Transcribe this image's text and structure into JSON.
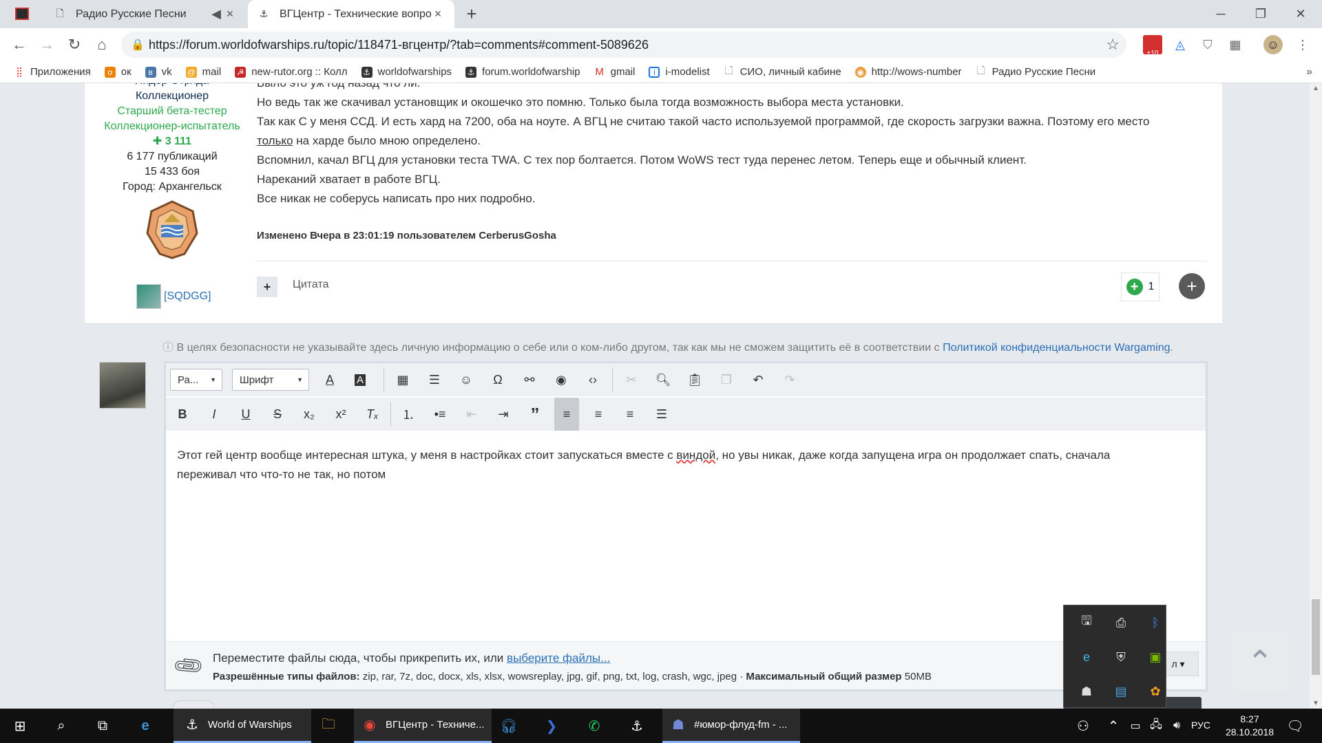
{
  "tabs": [
    {
      "title": "Радио Русские Песни",
      "icon": "document-icon"
    },
    {
      "title": "ВГЦентр - Технические вопросы",
      "icon": "wows-icon"
    }
  ],
  "new_tab_symbol": "+",
  "url": "https://forum.worldofwarships.ru/topic/118471-вгцентр/?tab=comments#comment-5089626",
  "extension_badge": "+10",
  "bookmarks": [
    {
      "label": "Приложения",
      "icon": "apps-icon",
      "color": "#e8453c"
    },
    {
      "label": "ок",
      "icon": "ok-icon",
      "color": "#ee8208"
    },
    {
      "label": "vk",
      "icon": "vk-icon",
      "color": "#4a76a8"
    },
    {
      "label": "mail",
      "icon": "mail-icon",
      "color": "#f5a623"
    },
    {
      "label": "new-rutor.org :: Колл",
      "icon": "rutor-icon",
      "color": "#c62828"
    },
    {
      "label": "worldofwarships",
      "icon": "wows-icon",
      "color": "#333"
    },
    {
      "label": "forum.worldofwarship",
      "icon": "wows-icon",
      "color": "#333"
    },
    {
      "label": "gmail",
      "icon": "gmail-icon",
      "color": "#d93025"
    },
    {
      "label": "i-modelist",
      "icon": "doc-icon",
      "color": "#1a73e8"
    },
    {
      "label": "СИО, личный кабине",
      "icon": "document-icon",
      "color": "#777"
    },
    {
      "label": "http://wows-number",
      "icon": "globe-icon",
      "color": "#f09a3e"
    },
    {
      "label": "Радио Русские Песни",
      "icon": "document-icon",
      "color": "#777"
    }
  ],
  "author": {
    "rank_partial": "Лидер Отряда",
    "title": "Коллекционер",
    "badge1": "Старший бета-тестер",
    "badge2": "Коллекционер-испытатель",
    "reputation": "3 111",
    "posts": "6 177 публикаций",
    "battles": "15 433 боя",
    "city": "Город: Архангельск",
    "clan": "[SQDGG]"
  },
  "post": {
    "lines": [
      "Было это уж год назад что ли.",
      "Но ведь так же скачивал установщик и окошечко это помню. Только была тогда возможность выбора места установки.",
      "Так как С у меня ССД. И есть хард на 7200, оба на ноуте. А ВГЦ не считаю такой часто используемой программой, где скорость загрузки важна. Поэтому его место",
      "на харде было мною определено.",
      "Вспомнил, качал ВГЦ для установки теста TWA. С тех пор болтается. Потом WoWS тест туда перенес летом. Теперь еще и обычный клиент.",
      "Нареканий хватает в работе ВГЦ.",
      "Все никак не соберусь написать про них подробно."
    ],
    "underlined_word": "только",
    "edited": "Изменено Вчера в 23:01:19 пользователем CerberusGosha",
    "quote": "Цитата",
    "plus": "+",
    "rep_count": "1"
  },
  "privacy": {
    "text": "В целях безопасности не указывайте здесь личную информацию о себе или о ком-либо другом, так как мы не сможем защитить её в соответствии с",
    "link": "Политикой конфиденциальности Wargaming",
    "end": "."
  },
  "editor": {
    "format_select": "Ра...",
    "font_select": "Шрифт",
    "text_before": "Этот гей центр вообще интересная штука, у меня в настройках стоит запускаться вместе с",
    "misspelled": "виндой",
    "text_after": ", но увы никак, даже когда запущена игра он продолжает спать, сначала",
    "text_line2": "переживал что что-то не так, но потом"
  },
  "attach": {
    "drop_text": "Переместите файлы сюда, чтобы прикрепить их, или",
    "drop_link": "выберите файлы...",
    "types_label": "Разрешённые типы файлов:",
    "types": "zip, rar, 7z, doc, docx, xls, xlsx, wowsreplay, jpg, gif, png, txt, log, crash, wgc, jpeg",
    "sep": "·",
    "max_label": "Максимальный общий размер",
    "max": "50MB",
    "more_btn": "л ▾"
  },
  "taskbar": {
    "items": [
      {
        "label": "World of Warships",
        "icon": "wows-icon"
      },
      {
        "label": "ВГЦентр - Техниче...",
        "icon": "chrome-icon"
      },
      {
        "label": "#юмор-флуд-fm - ...",
        "icon": "discord-icon"
      }
    ],
    "lang": "РУС",
    "time": "8:27",
    "date": "28.10.2018"
  }
}
